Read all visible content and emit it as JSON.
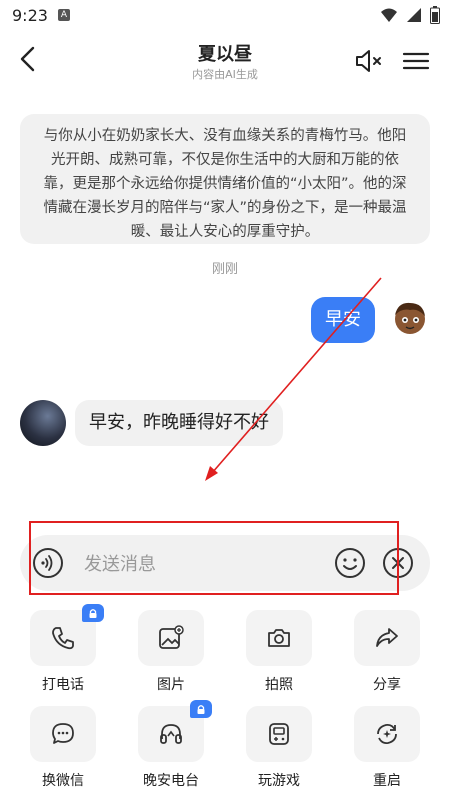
{
  "status_bar": {
    "time": "9:23",
    "notification_icon": "A"
  },
  "header": {
    "title": "夏以昼",
    "subtitle": "内容由AI生成"
  },
  "intro_text": "与你从小在奶奶家长大、没有血缘关系的青梅竹马。他阳光开朗、成熟可靠，不仅是你生活中的大厨和万能的依靠，更是那个永远给你提供情绪价值的“小太阳”。他的深情藏在漫长岁月的陪伴与“家人”的身份之下，是一种最温暖、最让人安心的厚重守护。",
  "timestamp": "刚刚",
  "messages": [
    {
      "from": "user",
      "text": "早安"
    },
    {
      "from": "bot",
      "text": "早安，昨晚睡得好不好"
    }
  ],
  "input": {
    "placeholder": "发送消息"
  },
  "tools": [
    {
      "label": "打电话",
      "icon": "phone-icon",
      "locked": true
    },
    {
      "label": "图片",
      "icon": "image-icon",
      "locked": false
    },
    {
      "label": "拍照",
      "icon": "camera-icon",
      "locked": false
    },
    {
      "label": "分享",
      "icon": "share-icon",
      "locked": false
    },
    {
      "label": "换微信",
      "icon": "chat-icon",
      "locked": false
    },
    {
      "label": "晚安电台",
      "icon": "headphones-icon",
      "locked": true
    },
    {
      "label": "玩游戏",
      "icon": "game-icon",
      "locked": false
    },
    {
      "label": "重启",
      "icon": "restart-icon",
      "locked": false
    }
  ],
  "colors": {
    "accent": "#3a7ef6",
    "annotation": "#e02020",
    "bubble": "#f1f1f1"
  }
}
